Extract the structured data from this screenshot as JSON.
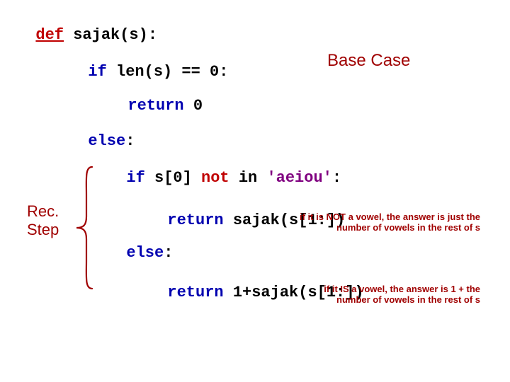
{
  "code": {
    "l1_def": "def",
    "l1_rest": " sajak(s):",
    "l2_if": "if",
    "l2_rest": " len(s) == 0:",
    "l3_return": "return",
    "l3_rest": " 0",
    "l4_else": "else",
    "l4_colon": ":",
    "l5_if": "if",
    "l5_rest_a": " s[0] ",
    "l5_not": "not",
    "l5_rest_b": " in ",
    "l5_str": "'aeiou'",
    "l5_colon": ":",
    "l6_return": "return",
    "l6_rest": " sajak(s[1:])",
    "l7_else": "else",
    "l7_colon": ":",
    "l8_return": "return",
    "l8_rest": " 1+sajak(s[1:])"
  },
  "annot": {
    "base": "Base Case",
    "rec1": "Rec.",
    "rec2": "Step",
    "note1": "if it is NOT a vowel, the answer is just the number of vowels in the rest of s",
    "note2": "if it IS a vowel, the answer is 1 + the number of vowels in the rest of s"
  }
}
